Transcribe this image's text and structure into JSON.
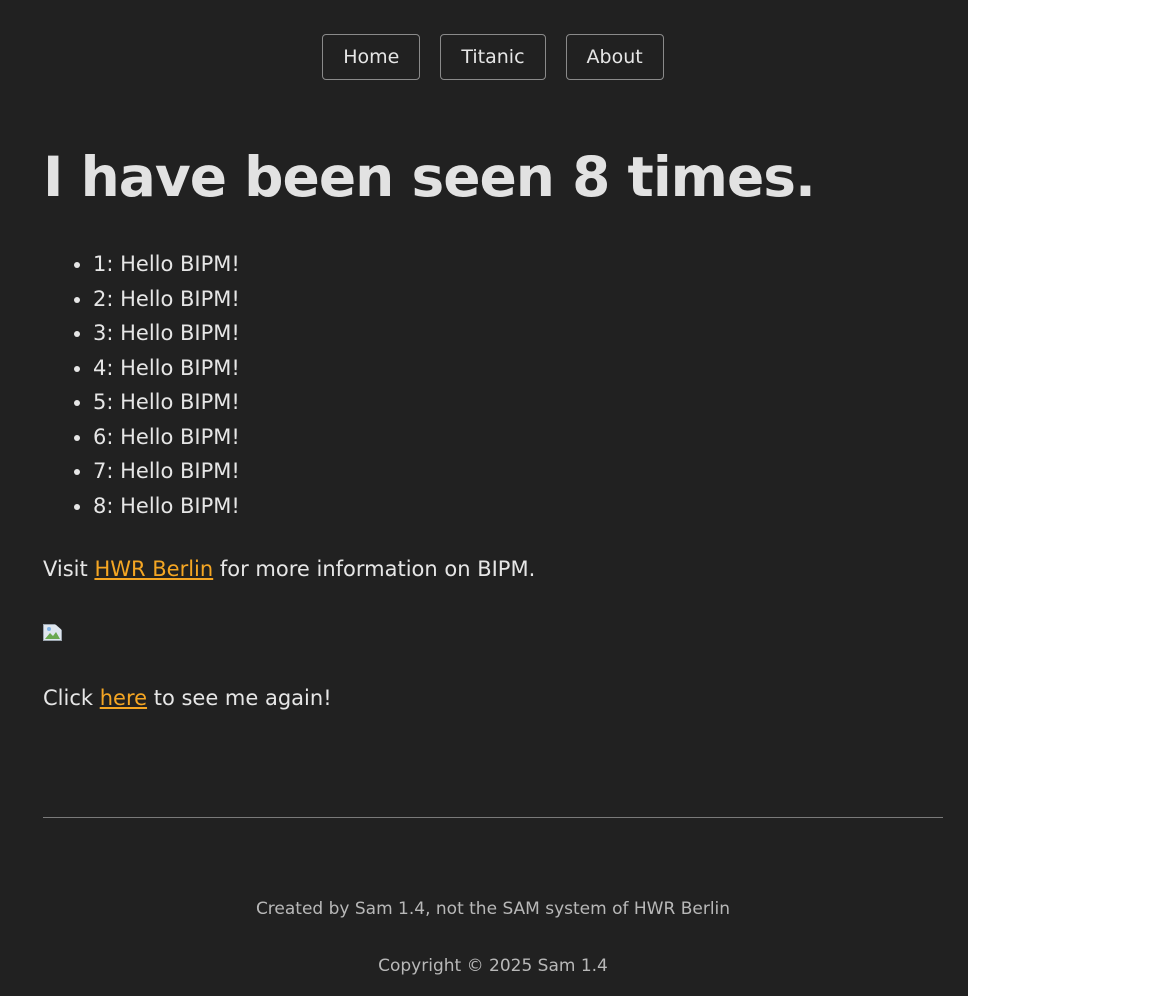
{
  "nav": {
    "items": [
      {
        "label": "Home"
      },
      {
        "label": "Titanic"
      },
      {
        "label": "About"
      }
    ]
  },
  "main": {
    "heading": "I have been seen 8 times.",
    "list": [
      "1: Hello BIPM!",
      "2: Hello BIPM!",
      "3: Hello BIPM!",
      "4: Hello BIPM!",
      "5: Hello BIPM!",
      "6: Hello BIPM!",
      "7: Hello BIPM!",
      "8: Hello BIPM!"
    ],
    "visit": {
      "before": "Visit ",
      "link": "HWR Berlin",
      "after": " for more information on BIPM."
    },
    "click": {
      "before": "Click ",
      "link": "here",
      "after": " to see me again!"
    }
  },
  "footer": {
    "created": "Created by Sam 1.4, not the SAM system of HWR Berlin",
    "copyright": "Copyright © 2025 Sam 1.4"
  },
  "colors": {
    "background": "#212121",
    "link": "#f5a623",
    "text": "#e6e6e6"
  }
}
